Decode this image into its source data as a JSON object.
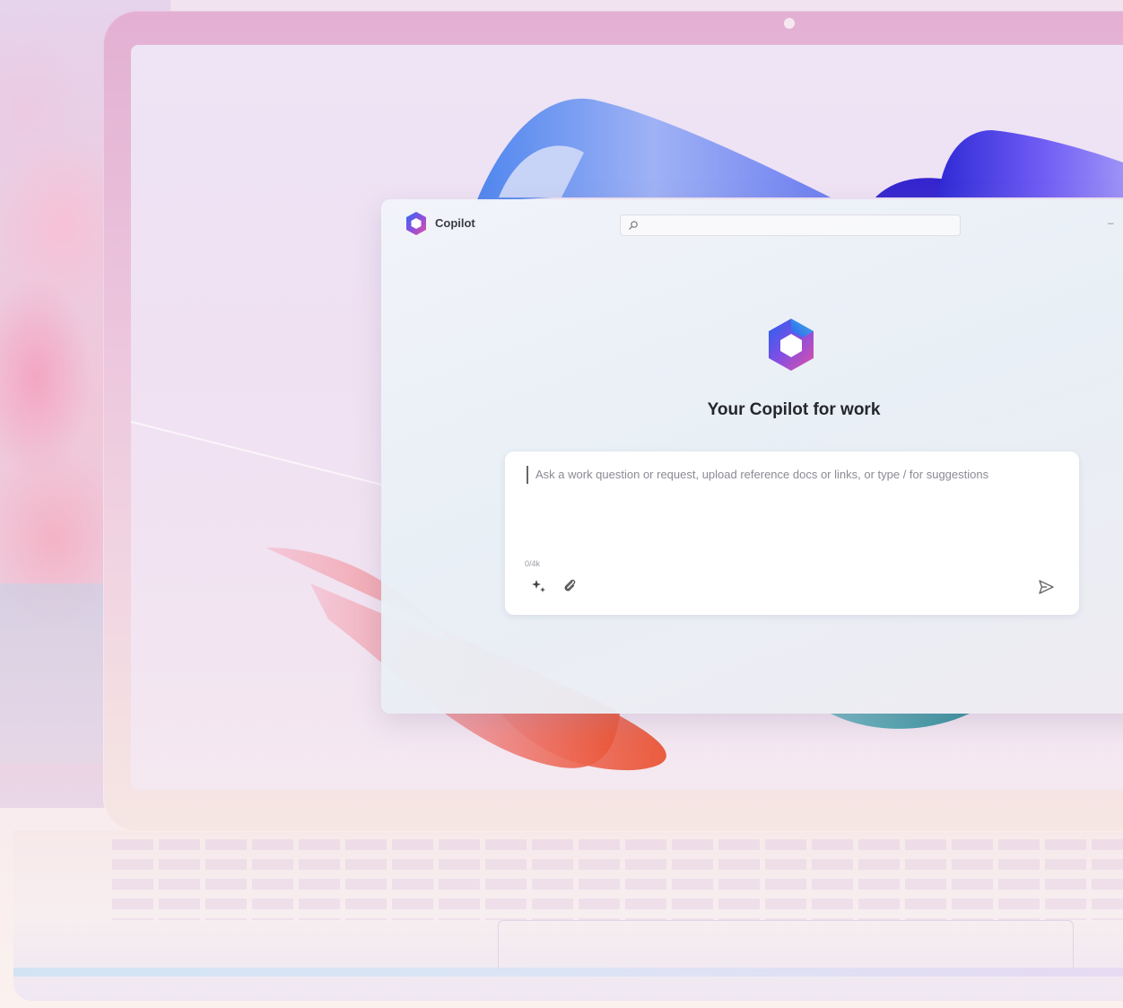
{
  "window": {
    "app_title": "Copilot",
    "search_placeholder": ""
  },
  "main": {
    "heading": "Your Copilot for work"
  },
  "compose": {
    "placeholder": "Ask a work question or request, upload reference docs or links, or type / for suggestions",
    "char_count": "0/4k"
  },
  "icons": {
    "app_logo": "copilot-logo",
    "hero_logo": "copilot-logo",
    "search": "search-icon",
    "prompts": "sparkle-icon",
    "attach": "paperclip-icon",
    "send": "send-icon",
    "minimize": "minimize-icon"
  },
  "colors": {
    "laptop_frame": "#e3b0d3",
    "ribbon_blue": "#7c8cf2",
    "ribbon_purple": "#6a4ff2",
    "ribbon_coral": "#ec5b44",
    "ribbon_teal": "#3d9a9f",
    "heading_text": "#26262e"
  }
}
